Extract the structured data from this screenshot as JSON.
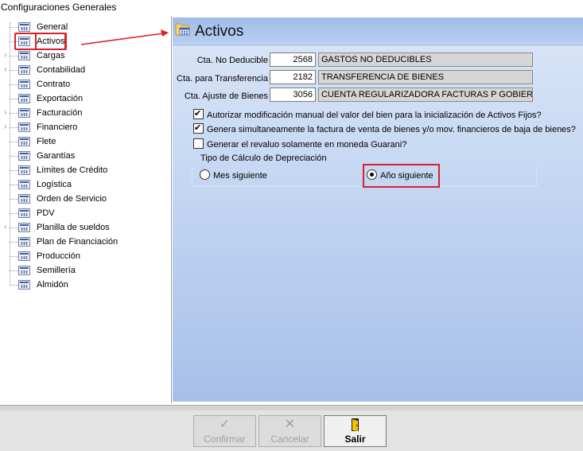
{
  "window": {
    "title": "Configuraciones Generales"
  },
  "tree": {
    "items": [
      {
        "label": "General",
        "icon": "grid-icon",
        "expandable": false
      },
      {
        "label": "Activos",
        "icon": "grid-icon",
        "expandable": false,
        "selected": true
      },
      {
        "label": "Cargas",
        "icon": "grid-icon",
        "expandable": true
      },
      {
        "label": "Contabilidad",
        "icon": "grid-icon",
        "expandable": true
      },
      {
        "label": "Contrato",
        "icon": "grid-icon",
        "expandable": false
      },
      {
        "label": "Exportación",
        "icon": "grid-icon",
        "expandable": false
      },
      {
        "label": "Facturación",
        "icon": "grid-icon",
        "expandable": true
      },
      {
        "label": "Financiero",
        "icon": "grid-icon",
        "expandable": true
      },
      {
        "label": "Flete",
        "icon": "grid-icon",
        "expandable": false
      },
      {
        "label": "Garantías",
        "icon": "grid-icon",
        "expandable": false
      },
      {
        "label": "Límites de Crédito",
        "icon": "grid-icon",
        "expandable": false
      },
      {
        "label": "Logística",
        "icon": "grid-icon",
        "expandable": false
      },
      {
        "label": "Orden de Servicio",
        "icon": "grid-icon",
        "expandable": false
      },
      {
        "label": "PDV",
        "icon": "grid-icon",
        "expandable": false
      },
      {
        "label": "Planilla de sueldos",
        "icon": "grid-icon",
        "expandable": true
      },
      {
        "label": "Plan de Financiación",
        "icon": "grid-icon",
        "expandable": false
      },
      {
        "label": "Producción",
        "icon": "grid-icon",
        "expandable": false
      },
      {
        "label": "Semillería",
        "icon": "grid-icon",
        "expandable": false
      },
      {
        "label": "Almidón",
        "icon": "grid-icon",
        "expandable": false
      }
    ]
  },
  "main": {
    "title": "Activos",
    "fields": [
      {
        "label": "Cta. No Deducible",
        "code": "2568",
        "description": "GASTOS NO DEDUCIBLES"
      },
      {
        "label": "Cta. para Transferencia",
        "code": "2182",
        "description": "TRANSFERENCIA DE BIENES"
      },
      {
        "label": "Cta. Ajuste de Bienes",
        "code": "3056",
        "description": "CUENTA REGULARIZADORA FACTURAS P GOBIERNO"
      }
    ],
    "checkboxes": [
      {
        "label": "Autorizar modificación manual del valor del bien para la inicialización de Activos Fijos?",
        "checked": true
      },
      {
        "label": "Genera simultaneamente la factura de venta de bienes y/o mov. financieros de baja de bienes?",
        "checked": true
      },
      {
        "label": "Generar el revaluo solamente en moneda Guarani?",
        "checked": false
      }
    ],
    "depreciation": {
      "title": "Tipo de Cálculo de Depreciación",
      "options": [
        {
          "label": "Mes siguiente",
          "selected": false
        },
        {
          "label": "Año siguiente",
          "selected": true
        }
      ]
    }
  },
  "footer": {
    "confirm_label": "Confirmar",
    "cancel_label": "Cancelar",
    "exit_label": "Salir"
  },
  "colors": {
    "highlight": "#d9202a",
    "panel_top": "#dbe6f7",
    "panel_bottom": "#a7c0e8"
  }
}
